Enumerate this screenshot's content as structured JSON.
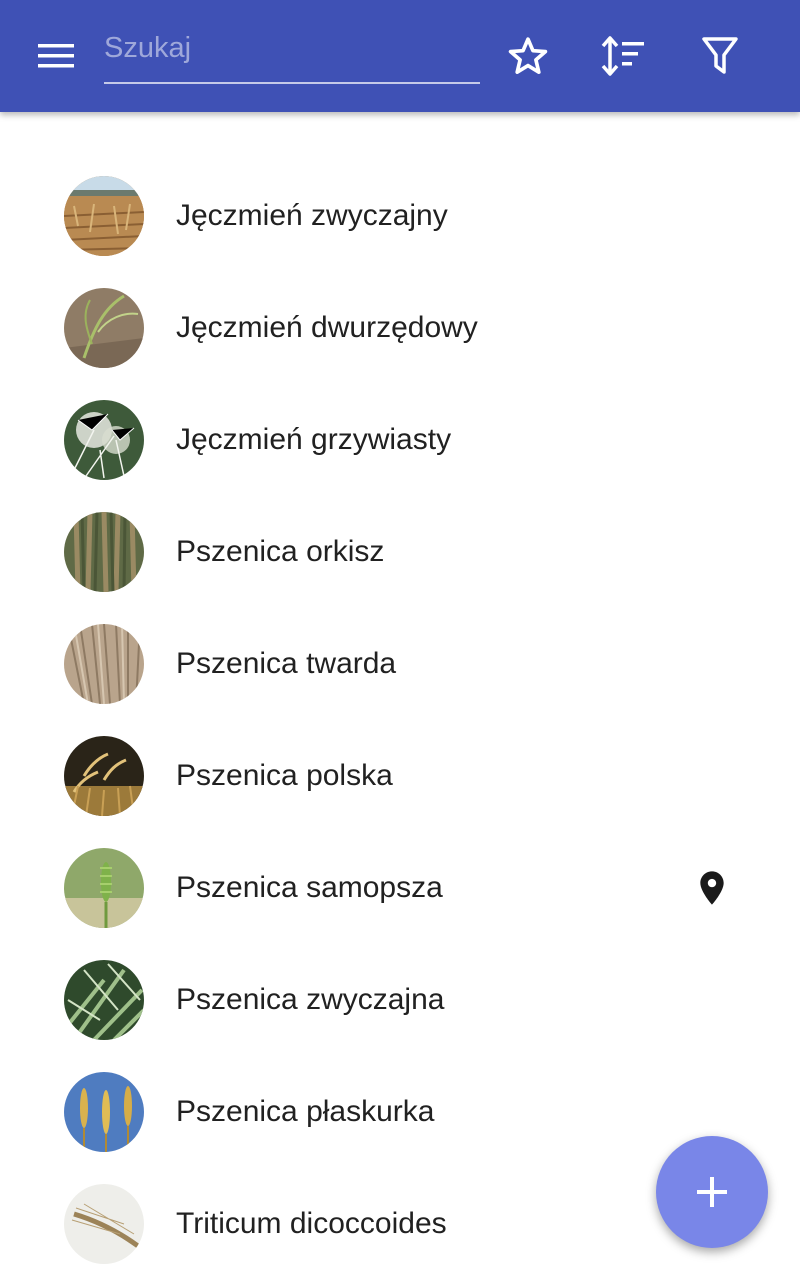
{
  "app_bar": {
    "background": "#3f51b5",
    "menu_icon": "menu-icon",
    "search": {
      "placeholder": "Szukaj",
      "value": ""
    },
    "actions": [
      "star-outline-icon",
      "sort-icon",
      "filter-icon"
    ]
  },
  "species": [
    {
      "name": "Jęczmień zwyczajny",
      "thumbnail": "barley-field-photo",
      "has_location": false
    },
    {
      "name": "Jęczmień dwurzędowy",
      "thumbnail": "barley-stalk-photo",
      "has_location": false
    },
    {
      "name": "Jęczmień grzywiasty",
      "thumbnail": "foxtail-barley-photo",
      "has_location": false
    },
    {
      "name": "Pszenica orkisz",
      "thumbnail": "spelt-photo",
      "has_location": false
    },
    {
      "name": "Pszenica twarda",
      "thumbnail": "durum-wheat-photo",
      "has_location": false
    },
    {
      "name": "Pszenica polska",
      "thumbnail": "polish-wheat-photo",
      "has_location": false
    },
    {
      "name": "Pszenica samopsza",
      "thumbnail": "einkorn-photo",
      "has_location": true
    },
    {
      "name": "Pszenica zwyczajna",
      "thumbnail": "common-wheat-photo",
      "has_location": false
    },
    {
      "name": "Pszenica płaskurka",
      "thumbnail": "emmer-photo",
      "has_location": false
    },
    {
      "name": "Triticum dicoccoides",
      "thumbnail": "wild-emmer-photo",
      "has_location": false
    }
  ],
  "fab": {
    "icon": "plus-icon",
    "color": "#7986e8"
  }
}
